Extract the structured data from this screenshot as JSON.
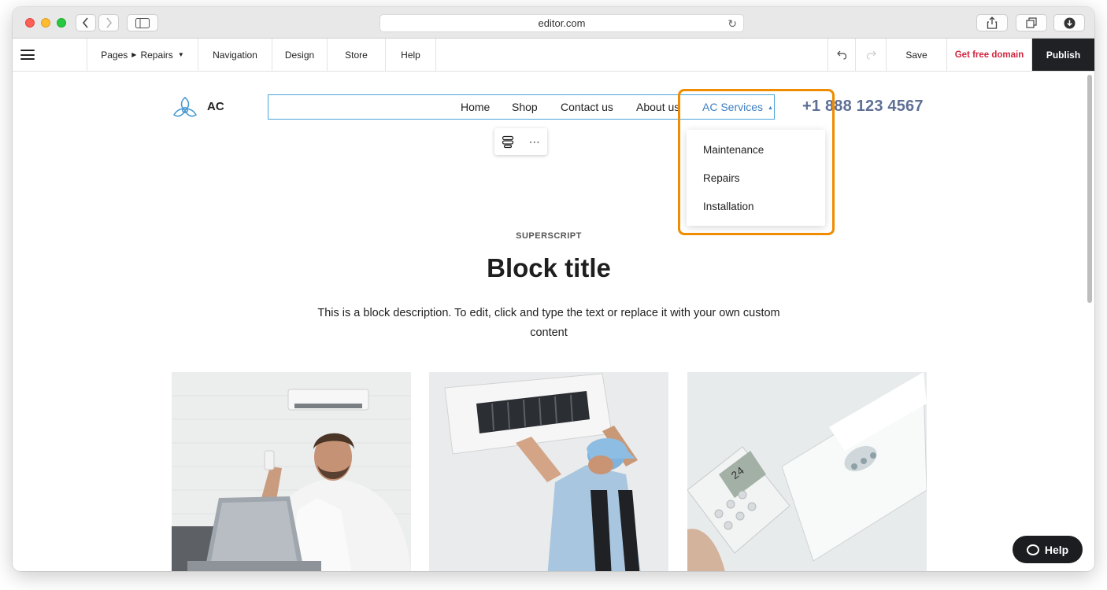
{
  "browser": {
    "url": "editor.com"
  },
  "toolbar": {
    "pages_label": "Pages",
    "current_page": "Repairs",
    "navigation_label": "Navigation",
    "design_label": "Design",
    "store_label": "Store",
    "help_label": "Help",
    "save_label": "Save",
    "domain_label": "Get free domain",
    "publish_label": "Publish",
    "domain_color": "#d0263f"
  },
  "site": {
    "brand": "AC",
    "nav": [
      "Home",
      "Shop",
      "Contact us",
      "About us",
      "AC Services"
    ],
    "phone": "+1 888 123 4567",
    "dropdown": [
      "Maintenance",
      "Repairs",
      "Installation"
    ],
    "accent_color": "#3e7fc1",
    "highlight_color": "#f08c00"
  },
  "block": {
    "superscript": "SUPERSCRIPT",
    "title": "Block title",
    "description": "This is a block description. To edit, click and type the text or replace it with your own custom content"
  },
  "images": [
    "man-with-laptop-and-remote",
    "technician-servicing-ac-unit",
    "hand-with-ac-remote"
  ],
  "help_button": {
    "label": "Help"
  }
}
